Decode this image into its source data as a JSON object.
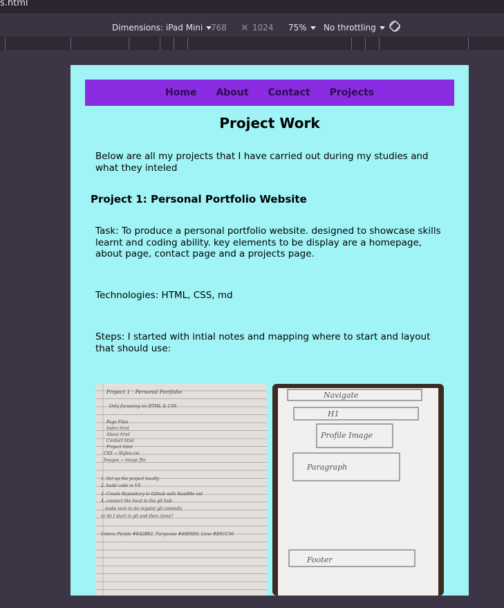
{
  "tab": {
    "title": "s.html"
  },
  "device_toolbar": {
    "dimensions_label": "Dimensions: iPad Mini",
    "width": "768",
    "times": "×",
    "height": "1024",
    "zoom": "75%",
    "throttling": "No throttling",
    "rotate_icon": "rotate-icon"
  },
  "page": {
    "nav": {
      "items": [
        "Home",
        "About",
        "Contact",
        "Projects"
      ]
    },
    "title": "Project Work",
    "intro": "Below are all my projects that I have carried out during my studies and what they inteled",
    "project_heading": "Project 1: Personal Portfolio Website",
    "task": "Task: To produce a personal portfolio website. designed to showcase skills learnt and coding ability. key elements to be display are a homepage, about page, contact page and a projects page.",
    "technologies": "Technologies: HTML, CSS, md",
    "steps": "Steps: I started with intial notes and mapping where to start and layout that should use:",
    "note_photo": {
      "lines": [
        "Project 1 - Personal Portfolio",
        "Only focussing on HTML & CSS",
        "Page Files",
        "Index html",
        "About html",
        "Contact html",
        "Project html",
        "CSS → Styles.css",
        "Images → image file",
        "1. Set up the project locally",
        "2. build code in VS",
        "3. Create Repository in Github with ReadMe md",
        "4. connect the local to the git hub",
        "make sure to do regular git commits",
        "or do I start in git and then clone?",
        "Colors: Purple #8A2BE2, Turquoise #40E0D0, Lime #BSCC36"
      ]
    },
    "sketch_photo": {
      "labels": [
        "Navigate",
        "H1",
        "Profile Image",
        "Paragraph",
        "Footer"
      ]
    }
  },
  "colors": {
    "nav_bg": "#8a2ce2",
    "page_bg": "#a1f4f6",
    "devtools_bg": "#3a3342"
  }
}
